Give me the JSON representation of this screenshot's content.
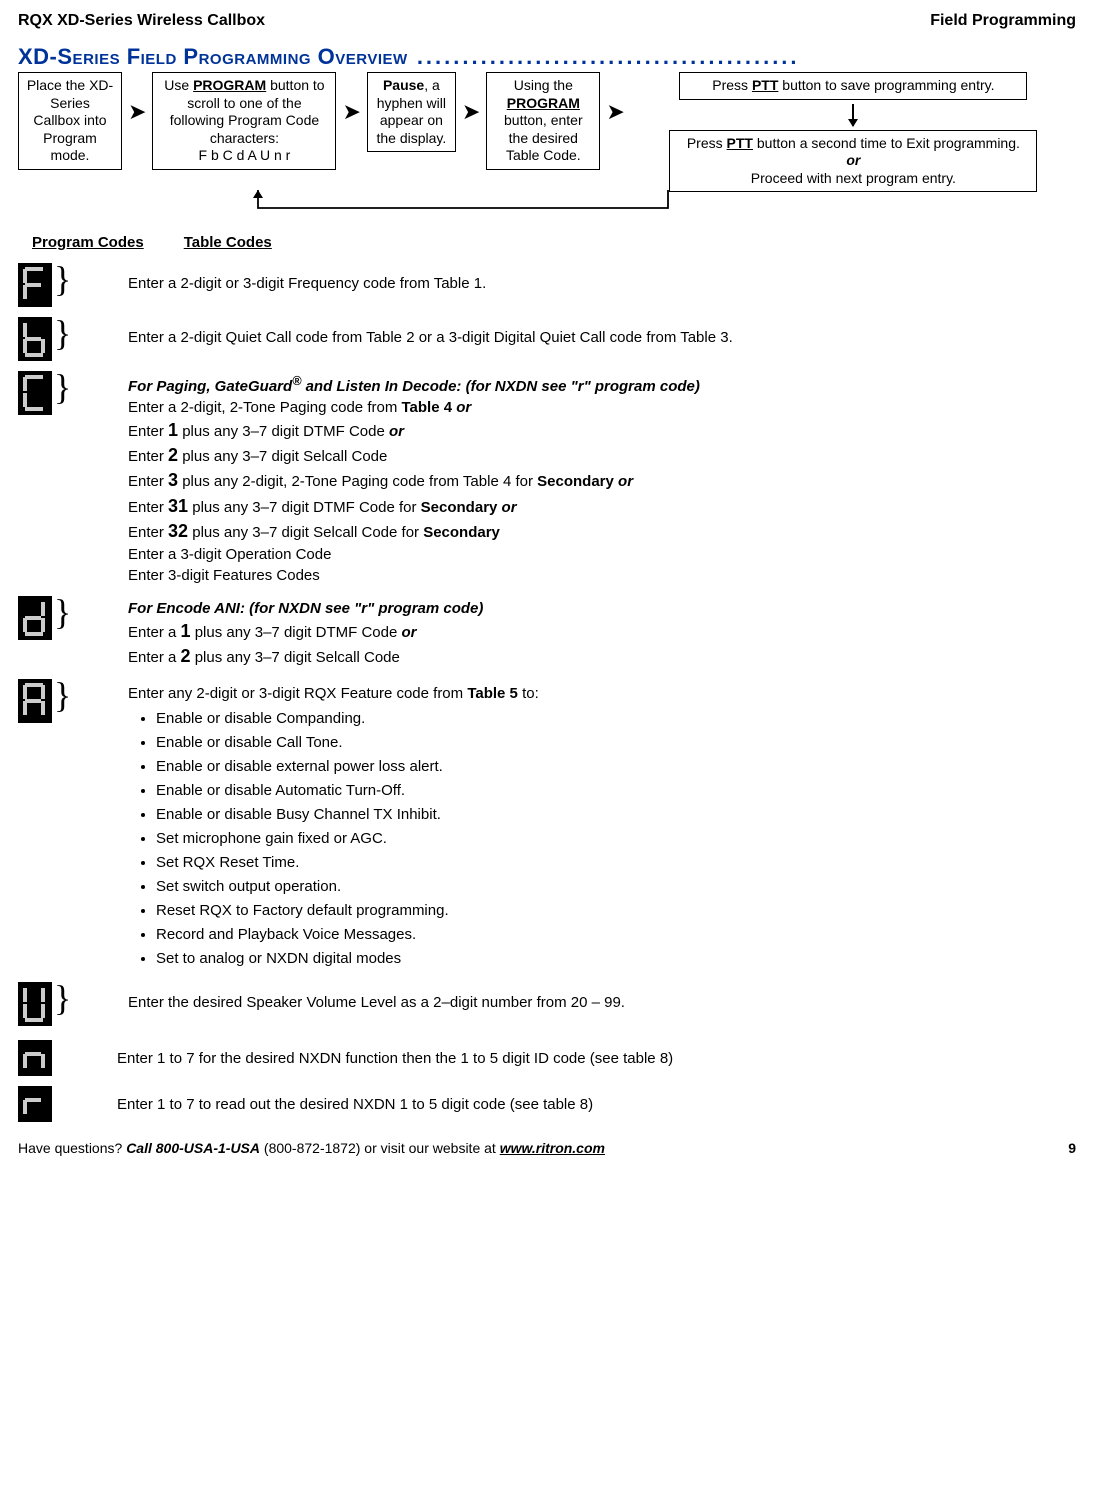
{
  "header": {
    "left": "RQX XD-Series Wireless Callbox",
    "right": "Field Programming"
  },
  "sectionTitle": "XD-Series Field Programming Overview",
  "flow": {
    "box1": "Place the XD-Series Callbox into Program mode.",
    "box2_pre": "Use ",
    "box2_bold": "PROGRAM",
    "box2_post": " button to scroll to one of the following Program Code characters:",
    "box2_codes": "F  b  C  d  A  U  n  r",
    "box3_bold": "Pause",
    "box3_post": ", a hyphen will appear on the display.",
    "box4_pre": "Using the ",
    "box4_bold": "PROGRAM",
    "box4_post": " button, enter the desired Table Code.",
    "box5_pre": "Press ",
    "box5_bold": "PTT",
    "box5_post": " button to save programming entry.",
    "box6_pre": "Press ",
    "box6_bold": "PTT",
    "box6_post1": " button a second time to Exit programming.",
    "box6_or": "or",
    "box6_post2": "Proceed with next program entry."
  },
  "th": {
    "pc": "Program Codes",
    "tc": "Table Codes"
  },
  "rowF": "Enter a 2-digit or 3-digit Frequency code from Table 1.",
  "rowB": "Enter a 2-digit Quiet Call code from Table 2 or a 3-digit Digital Quiet Call code from Table 3.",
  "rowC": {
    "head_pre": "For Paging, GateGuard",
    "head_post": " and Listen In Decode:  (for NXDN see \"r\" program code)",
    "l1_pre": "Enter a 2-digit, 2-Tone Paging code from ",
    "l1_b": "Table 4",
    "l1_or": " or",
    "l2_pre": "Enter ",
    "l2_n": "1",
    "l2_post": " plus any 3–7 digit DTMF Code ",
    "l2_or": "or",
    "l3_pre": "Enter ",
    "l3_n": "2",
    "l3_post": " plus any 3–7 digit Selcall Code",
    "l4_pre": "Enter ",
    "l4_n": "3",
    "l4_post": " plus any 2-digit, 2-Tone Paging code from Table 4 for ",
    "l4_b": "Secondary",
    "l4_or": " or",
    "l5_pre": "Enter ",
    "l5_n": "31",
    "l5_post": " plus any 3–7 digit DTMF Code for ",
    "l5_b": "Secondary",
    "l5_or": " or",
    "l6_pre": "Enter ",
    "l6_n": "32",
    "l6_post": " plus any 3–7 digit Selcall Code for ",
    "l6_b": "Secondary",
    "l7": "Enter a 3-digit Operation Code",
    "l8": "Enter 3-digit Features Codes"
  },
  "rowD": {
    "head": "For Encode ANI:   (for NXDN see \"r\" program code)",
    "l1_pre": "Enter a ",
    "l1_n": "1",
    "l1_post": " plus any 3–7 digit DTMF Code ",
    "l1_or": "or",
    "l2_pre": "Enter a ",
    "l2_n": "2",
    "l2_post": " plus any 3–7 digit Selcall Code"
  },
  "rowA": {
    "l1_pre": "Enter any 2-digit or 3-digit RQX Feature code from ",
    "l1_b": "Table 5",
    "l1_post": " to:",
    "items": [
      "Enable or disable Companding.",
      "Enable or disable Call Tone.",
      "Enable or disable external power loss alert.",
      "Enable or disable Automatic Turn-Off.",
      "Enable or disable Busy Channel TX Inhibit.",
      "Set microphone gain fixed or AGC.",
      "Set RQX Reset Time.",
      "Set switch output operation.",
      "Reset RQX to Factory default programming.",
      "Record and Playback Voice Messages.",
      "Set to analog or NXDN digital modes"
    ]
  },
  "rowU": "Enter the desired Speaker Volume Level as a 2–digit number from 20 – 99.",
  "rowN": "Enter 1 to 7 for the desired NXDN function then the 1 to 5 digit ID code (see table 8)",
  "rowR": "Enter 1 to 7 to read out the desired NXDN 1 to 5 digit code (see table 8)",
  "footer": {
    "q": "Have questions?  ",
    "call": "Call 800-USA-1-USA",
    "paren": " (800-872-1872) or visit our website at ",
    "url": "www.ritron.com",
    "page": "9"
  }
}
